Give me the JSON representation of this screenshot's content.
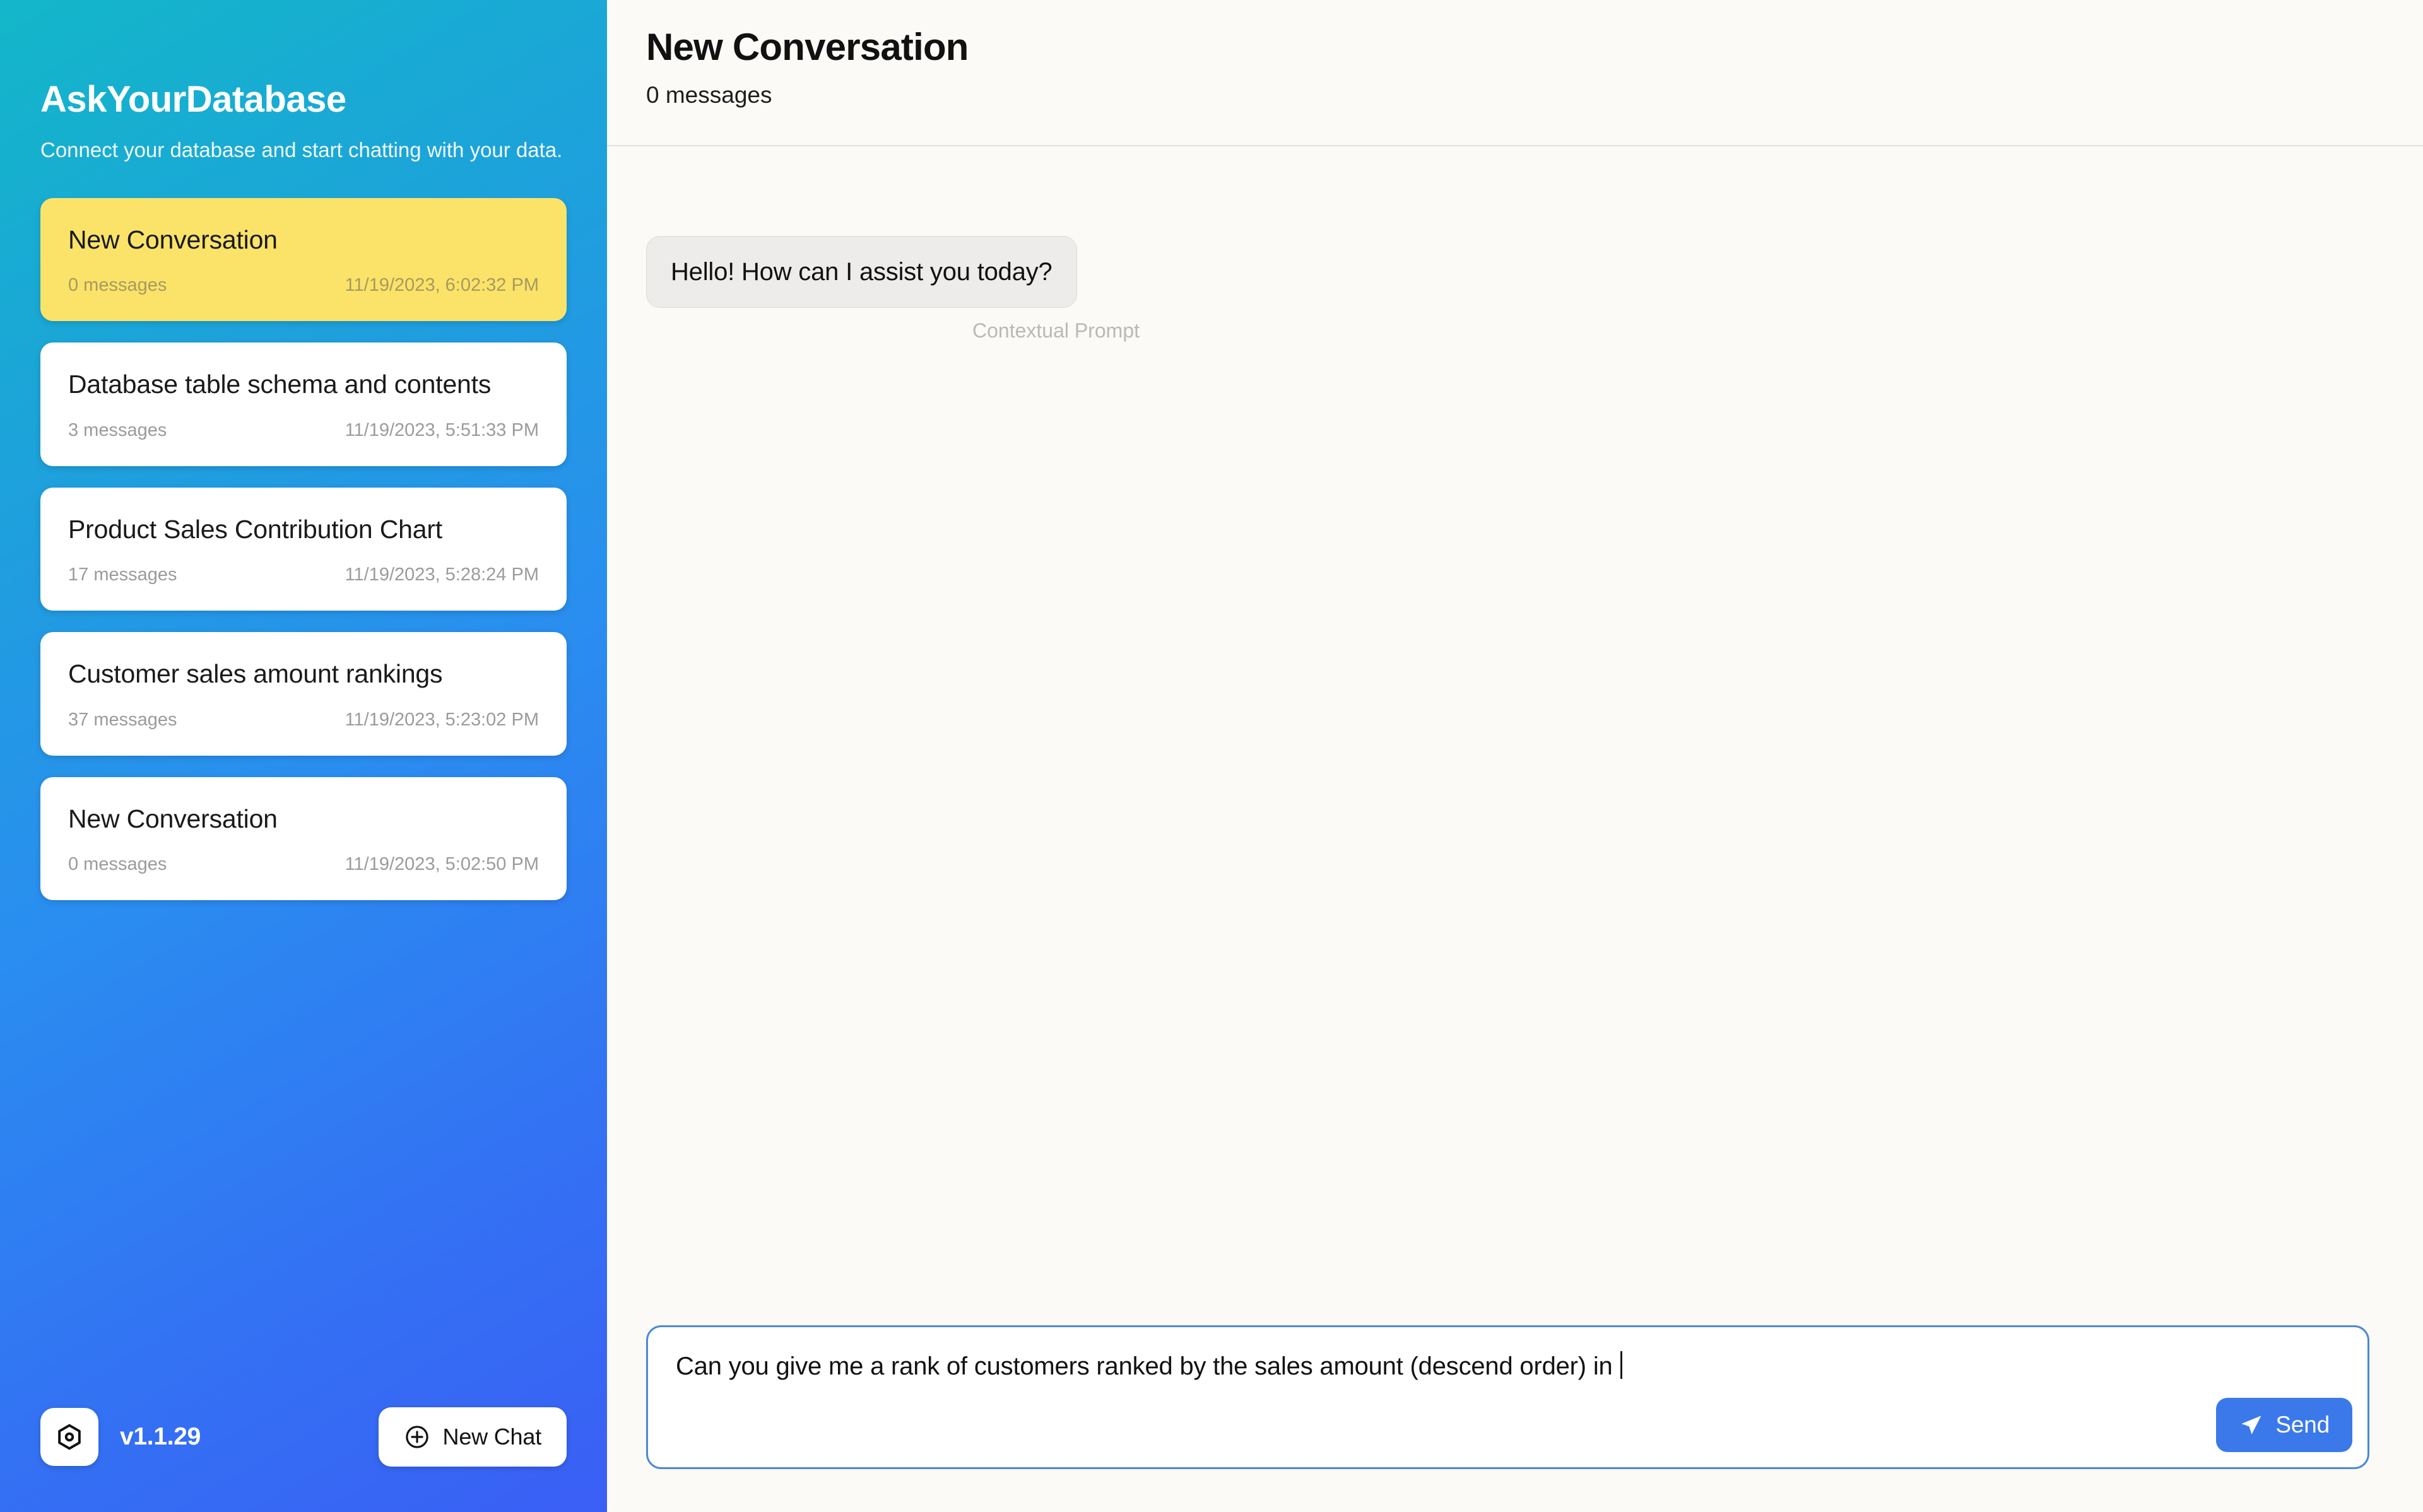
{
  "sidebar": {
    "brand_title": "AskYourDatabase",
    "brand_subtitle": "Connect your database and start chatting with your data.",
    "conversations": [
      {
        "title": "New Conversation",
        "messages": "0 messages",
        "date": "11/19/2023, 6:02:32 PM",
        "selected": true
      },
      {
        "title": "Database table schema and contents",
        "messages": "3 messages",
        "date": "11/19/2023, 5:51:33 PM",
        "selected": false
      },
      {
        "title": "Product Sales Contribution Chart",
        "messages": "17 messages",
        "date": "11/19/2023, 5:28:24 PM",
        "selected": false
      },
      {
        "title": "Customer sales amount rankings",
        "messages": "37 messages",
        "date": "11/19/2023, 5:23:02 PM",
        "selected": false
      },
      {
        "title": "New Conversation",
        "messages": "0 messages",
        "date": "11/19/2023, 5:02:50 PM",
        "selected": false
      }
    ],
    "footer": {
      "settings_icon": "hex-nut-settings-icon",
      "version": "v1.1.29",
      "new_chat_icon": "plus-circle-icon",
      "new_chat_label": "New Chat"
    }
  },
  "main": {
    "title": "New Conversation",
    "subtitle": "0 messages",
    "messages": [
      {
        "text": "Hello! How can I assist you today?",
        "tag": "Contextual Prompt"
      }
    ],
    "composer": {
      "value": "Can you give me a rank of customers ranked by the sales amount (descend order) in ",
      "placeholder": "Type your message...",
      "send_icon": "paper-plane-icon",
      "send_label": "Send"
    }
  },
  "colors": {
    "sidebar_gradient_start": "#13b7c9",
    "sidebar_gradient_end": "#3a5ff5",
    "selected_conversation": "#fbe36a",
    "send_button": "#3b79ea",
    "input_focus_border": "#4a89d8"
  }
}
